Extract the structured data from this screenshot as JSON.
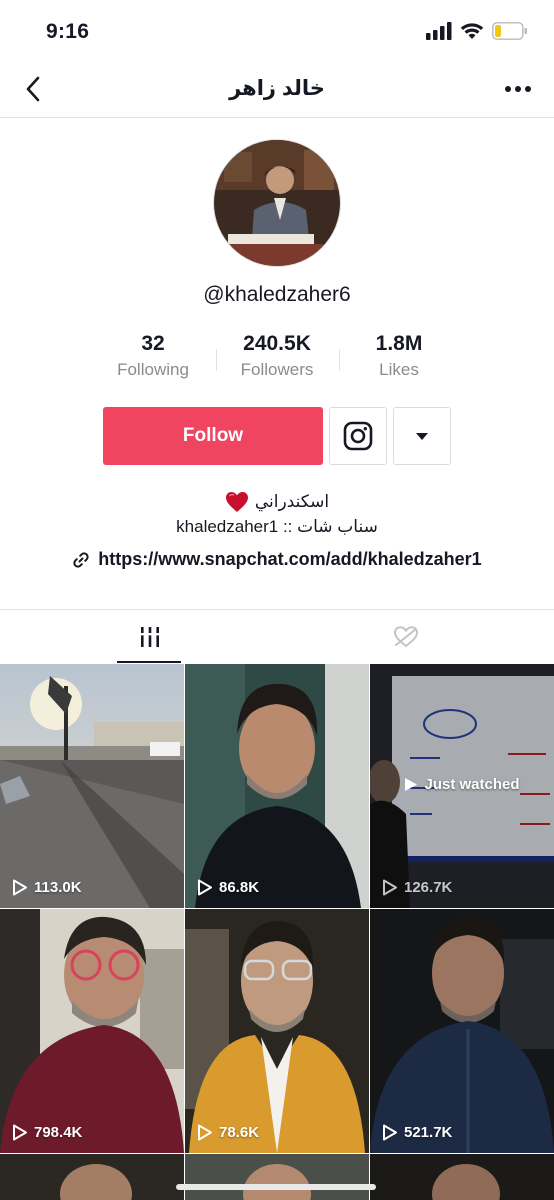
{
  "status": {
    "time": "9:16"
  },
  "nav": {
    "title": "خالد زاهر"
  },
  "profile": {
    "username": "@khaledzaher6",
    "stats": [
      {
        "value": "32",
        "label": "Following"
      },
      {
        "value": "240.5K",
        "label": "Followers"
      },
      {
        "value": "1.8M",
        "label": "Likes"
      }
    ],
    "follow_label": "Follow",
    "bio_line1": "اسكندراني",
    "bio_line2": "سناب شات :: khaledzaher1",
    "link": "https://www.snapchat.com/add/khaledzaher1"
  },
  "colors": {
    "accent": "#EF4561",
    "text": "#161823",
    "muted": "#8A8B91"
  },
  "videos": [
    {
      "views": "113.0K"
    },
    {
      "views": "86.8K"
    },
    {
      "views": "126.7K",
      "badge": "Just watched"
    },
    {
      "views": "798.4K"
    },
    {
      "views": "78.6K"
    },
    {
      "views": "521.7K"
    }
  ]
}
